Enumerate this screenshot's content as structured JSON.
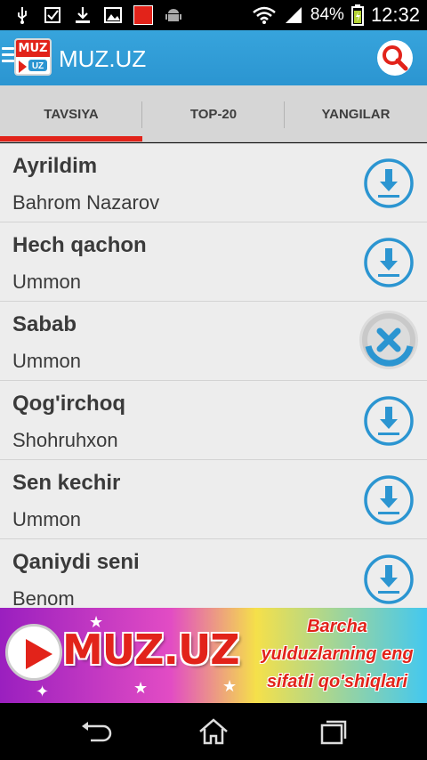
{
  "status_bar": {
    "battery": "84%",
    "time": "12:32",
    "left_icons": [
      "usb-icon",
      "checkbox-icon",
      "download-icon",
      "image-icon",
      "muz-app-icon",
      "android-icon"
    ],
    "right_icons": [
      "wifi-icon",
      "signal-icon",
      "battery-icon"
    ]
  },
  "header": {
    "logo_top": "MUZ",
    "logo_bottom": "UZ",
    "title": "MUZ.UZ",
    "menu_icon": "hamburger-icon",
    "search_icon": "search-icon"
  },
  "tabs": [
    {
      "label": "TAVSIYA",
      "active": true
    },
    {
      "label": "TOP-20",
      "active": false
    },
    {
      "label": "YANGILAR",
      "active": false
    }
  ],
  "songs": [
    {
      "title": "Ayrildim",
      "artist": "Bahrom Nazarov",
      "state": "download"
    },
    {
      "title": "Hech qachon",
      "artist": "Ummon",
      "state": "download"
    },
    {
      "title": "Sabab",
      "artist": "Ummon",
      "state": "downloading"
    },
    {
      "title": "Qog'irchoq",
      "artist": "Shohruhxon",
      "state": "download"
    },
    {
      "title": "Sen kechir",
      "artist": "Ummon",
      "state": "download"
    },
    {
      "title": "Qaniydi seni",
      "artist": "Benom",
      "state": "download"
    }
  ],
  "banner": {
    "logo": "MUZ.UZ",
    "line1": "Barcha",
    "line2": "yulduzlarning eng",
    "line3": "sifatli qo'shiqlari"
  },
  "colors": {
    "accent_blue": "#2b95d1",
    "accent_red": "#e2231a",
    "list_bg": "#ededed"
  },
  "nav": [
    "back-icon",
    "home-icon",
    "recents-icon"
  ]
}
